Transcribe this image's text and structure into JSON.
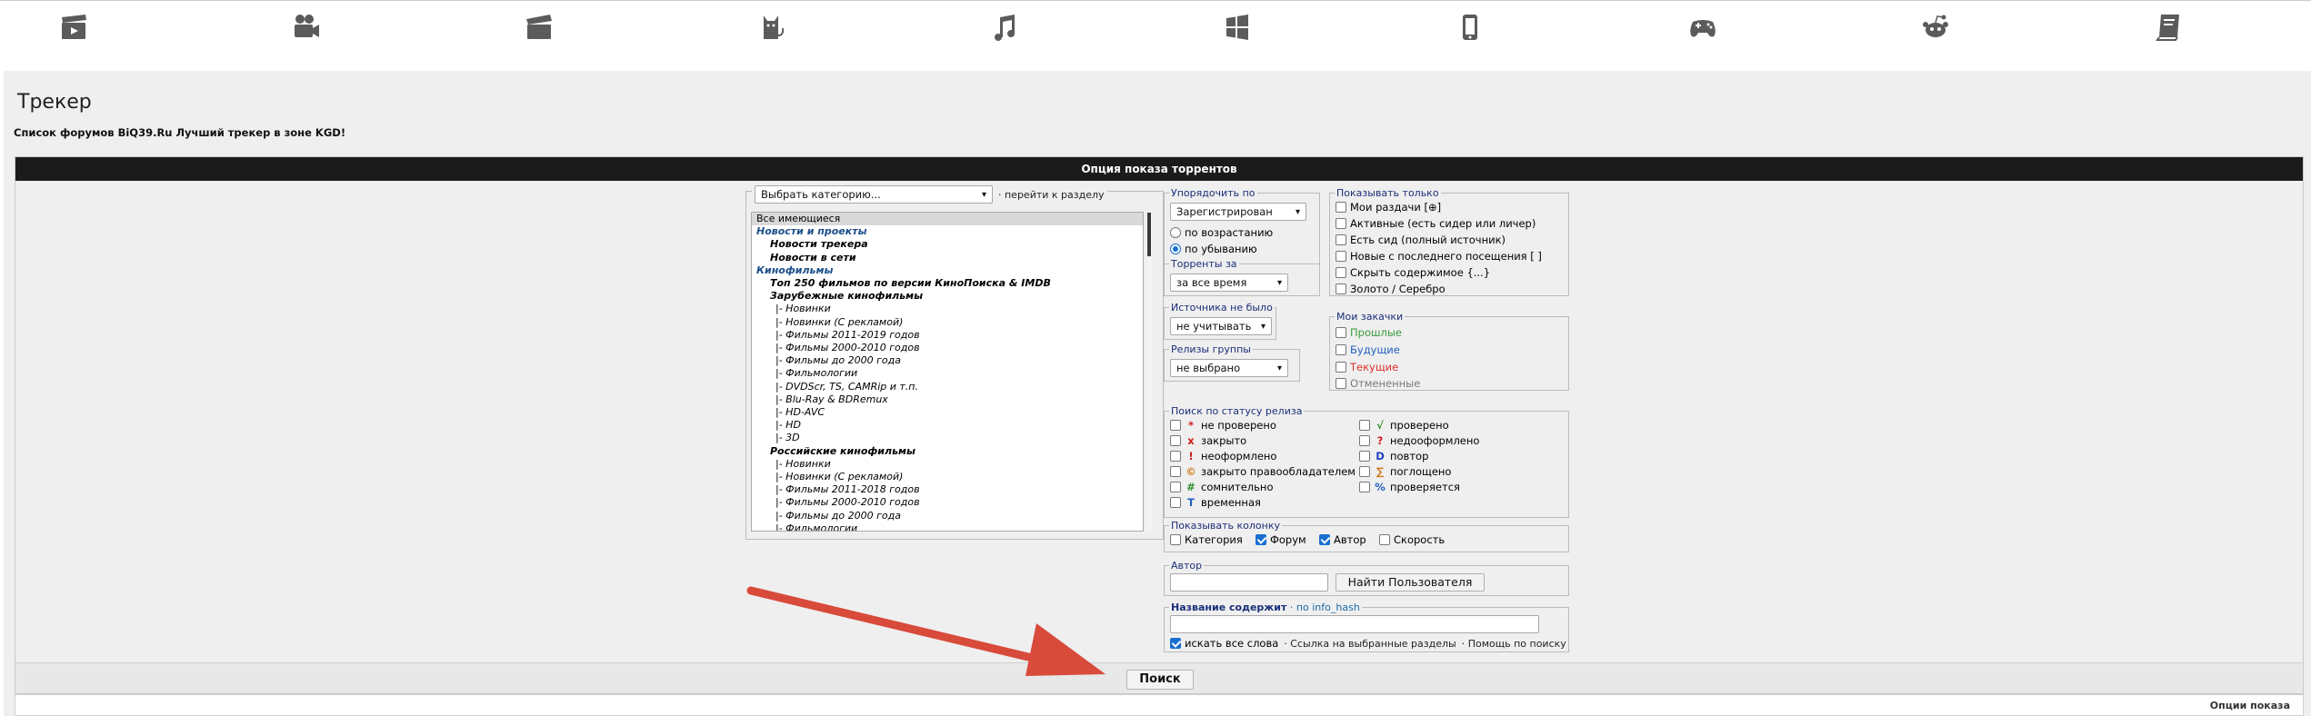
{
  "nav": {
    "icons": [
      "film-icon",
      "video-camera-icon",
      "clapperboard-icon",
      "cat-icon",
      "music-icon",
      "windows-icon",
      "phone-icon",
      "gamepad-icon",
      "reddit-alien-icon",
      "book-icon"
    ]
  },
  "page": {
    "title": "Трекер",
    "subtitle": "Список форумов BiQ39.Ru Лучший трекер в зоне KGD!"
  },
  "panel": {
    "header": "Опция показа торрентов",
    "search_button": "Поиск",
    "bottom_options": "Опции показа"
  },
  "category": {
    "select_value": "Выбрать категорию...",
    "goto_link": "· перейти к разделу",
    "items": [
      {
        "label": "Все имеющиеся",
        "kind": "sel"
      },
      {
        "label": "Новости и проекты",
        "kind": "group"
      },
      {
        "label": "Новости трекера",
        "kind": "sub"
      },
      {
        "label": "Новости в сети",
        "kind": "sub"
      },
      {
        "label": "Кинофильмы",
        "kind": "group"
      },
      {
        "label": "Топ 250 фильмов по версии КиноПоиска & IMDB",
        "kind": "sub"
      },
      {
        "label": "Зарубежные кинофильмы",
        "kind": "sub"
      },
      {
        "label": "|- Новинки",
        "kind": "leaf"
      },
      {
        "label": "|- Новинки (С рекламой)",
        "kind": "leaf"
      },
      {
        "label": "|- Фильмы 2011-2019 годов",
        "kind": "leaf"
      },
      {
        "label": "|- Фильмы 2000-2010 годов",
        "kind": "leaf"
      },
      {
        "label": "|- Фильмы до 2000 года",
        "kind": "leaf"
      },
      {
        "label": "|- Фильмологии",
        "kind": "leaf"
      },
      {
        "label": "|- DVDScr, TS, CAMRip и т.п.",
        "kind": "leaf"
      },
      {
        "label": "|- Blu-Ray & BDRemux",
        "kind": "leaf"
      },
      {
        "label": "|- HD-AVC",
        "kind": "leaf"
      },
      {
        "label": "|- HD",
        "kind": "leaf"
      },
      {
        "label": "|- 3D",
        "kind": "leaf"
      },
      {
        "label": "Российские кинофильмы",
        "kind": "sub"
      },
      {
        "label": "|- Новинки",
        "kind": "leaf"
      },
      {
        "label": "|- Новинки (С рекламой)",
        "kind": "leaf"
      },
      {
        "label": "|- Фильмы 2011-2018 годов",
        "kind": "leaf"
      },
      {
        "label": "|- Фильмы 2000-2010 годов",
        "kind": "leaf"
      },
      {
        "label": "|- Фильмы до 2000 года",
        "kind": "leaf"
      },
      {
        "label": "|- Фильмологии",
        "kind": "leaf"
      }
    ]
  },
  "sort": {
    "legend": "Упорядочить по",
    "select_value": "Зарегистрирован",
    "asc": "по возрастанию",
    "desc": "по убыванию"
  },
  "period": {
    "legend": "Торренты за",
    "select_value": "за все время"
  },
  "no_source": {
    "legend": "Источника не было",
    "select_value": "не учитывать"
  },
  "release_groups": {
    "legend": "Релизы группы",
    "select_value": "не выбрано"
  },
  "show_only": {
    "legend": "Показывать только",
    "items": [
      "Мои раздачи [⊕]",
      "Активные (есть сидер или личер)",
      "Есть сид (полный источник)",
      "Новые с последнего посещения [ ]",
      "Скрыть содержимое {...}",
      "Золото / Серебро"
    ]
  },
  "my_downloads": {
    "legend": "Мои закачки",
    "items": [
      {
        "label": "Прошлые",
        "color": "#3a9a3a"
      },
      {
        "label": "Будущие",
        "color": "#1f5fbf"
      },
      {
        "label": "Текущие",
        "color": "#e0302c"
      },
      {
        "label": "Отмененные",
        "color": "#7a7a7a"
      }
    ]
  },
  "status": {
    "legend": "Поиск по статусу релиза",
    "left": [
      {
        "icon": "*",
        "color": "#d21b1b",
        "label": "не проверено"
      },
      {
        "icon": "x",
        "color": "#d21b1b",
        "label": "закрыто"
      },
      {
        "icon": "!",
        "color": "#d21b1b",
        "label": "неоформлено"
      },
      {
        "icon": "©",
        "color": "#d27a1b",
        "label": "закрыто правообладателем"
      },
      {
        "icon": "#",
        "color": "#2f8f2f",
        "label": "сомнительно"
      },
      {
        "icon": "T",
        "color": "#1f5fbf",
        "label": "временная"
      }
    ],
    "right": [
      {
        "icon": "√",
        "color": "#2f8f2f",
        "label": "проверено"
      },
      {
        "icon": "?",
        "color": "#d21b1b",
        "label": "недооформлено"
      },
      {
        "icon": "D",
        "color": "#1f3fbf",
        "label": "повтор"
      },
      {
        "icon": "∑",
        "color": "#d27a1b",
        "label": "поглощено"
      },
      {
        "icon": "%",
        "color": "#1f5fbf",
        "label": "проверяется"
      }
    ]
  },
  "columns": {
    "legend": "Показывать колонку",
    "items": [
      {
        "label": "Категория",
        "checked": false
      },
      {
        "label": "Форум",
        "checked": true
      },
      {
        "label": "Автор",
        "checked": true
      },
      {
        "label": "Скорость",
        "checked": false
      }
    ]
  },
  "author": {
    "legend": "Автор",
    "find_button": "Найти Пользователя"
  },
  "title_search": {
    "legend_bold": "Название содержит",
    "legend_extra": "· по info_hash",
    "all_words": "искать все слова",
    "link_sections": "· Ссылка на выбранные разделы",
    "link_help": "· Помощь по поиску"
  }
}
